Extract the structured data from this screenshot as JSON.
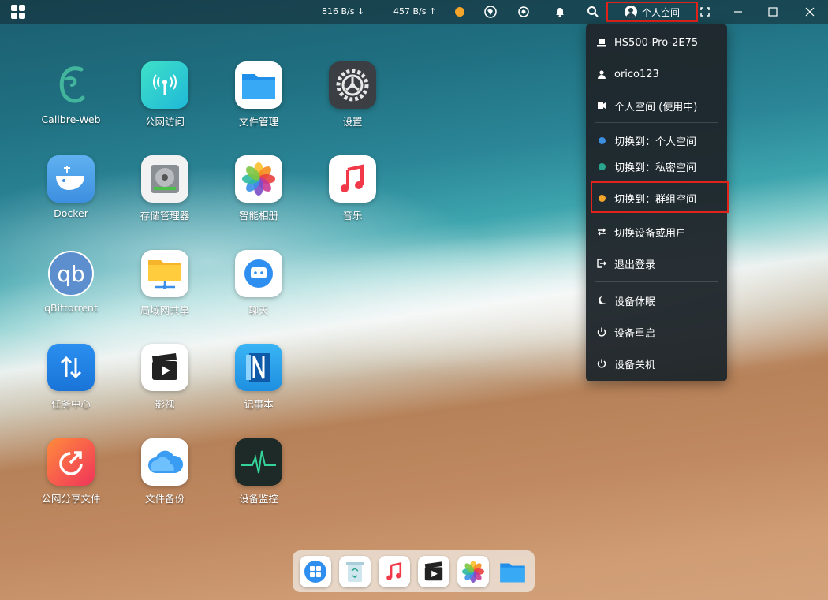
{
  "topbar": {
    "download_speed": "816 B/s",
    "upload_speed": "457 B/s",
    "space_label": "个人空间"
  },
  "apps": [
    {
      "label": "Calibre-Web",
      "icon": "calibre-web-icon"
    },
    {
      "label": "公网访问",
      "icon": "public-access-icon"
    },
    {
      "label": "文件管理",
      "icon": "file-manager-icon"
    },
    {
      "label": "设置",
      "icon": "settings-icon"
    },
    {
      "label": "Docker",
      "icon": "docker-icon"
    },
    {
      "label": "存储管理器",
      "icon": "storage-manager-icon"
    },
    {
      "label": "智能相册",
      "icon": "smart-album-icon"
    },
    {
      "label": "音乐",
      "icon": "music-icon"
    },
    {
      "label": "qBittorrent",
      "icon": "qbittorrent-icon"
    },
    {
      "label": "局域网共享",
      "icon": "lan-share-icon"
    },
    {
      "label": "聊天",
      "icon": "chat-icon"
    },
    {
      "label": "任务中心",
      "icon": "task-center-icon"
    },
    {
      "label": "影视",
      "icon": "video-icon"
    },
    {
      "label": "记事本",
      "icon": "notepad-icon"
    },
    {
      "label": "公网分享文件",
      "icon": "public-share-icon"
    },
    {
      "label": "文件备份",
      "icon": "file-backup-icon"
    },
    {
      "label": "设备监控",
      "icon": "device-monitor-icon"
    }
  ],
  "menu": {
    "device_name": "HS500-Pro-2E75",
    "username": "orico123",
    "current_space": "个人空间 (使用中)",
    "switch_personal": "切换到：个人空间",
    "switch_private": "切换到：私密空间",
    "switch_group": "切换到：群组空间",
    "switch_device_user": "切换设备或用户",
    "logout": "退出登录",
    "sleep": "设备休眠",
    "restart": "设备重启",
    "shutdown": "设备关机"
  },
  "colors": {
    "personal_dot": "#3d8fe0",
    "private_dot": "#2aa58f",
    "group_dot": "#f4a52a",
    "highlight": "#e2231a"
  }
}
